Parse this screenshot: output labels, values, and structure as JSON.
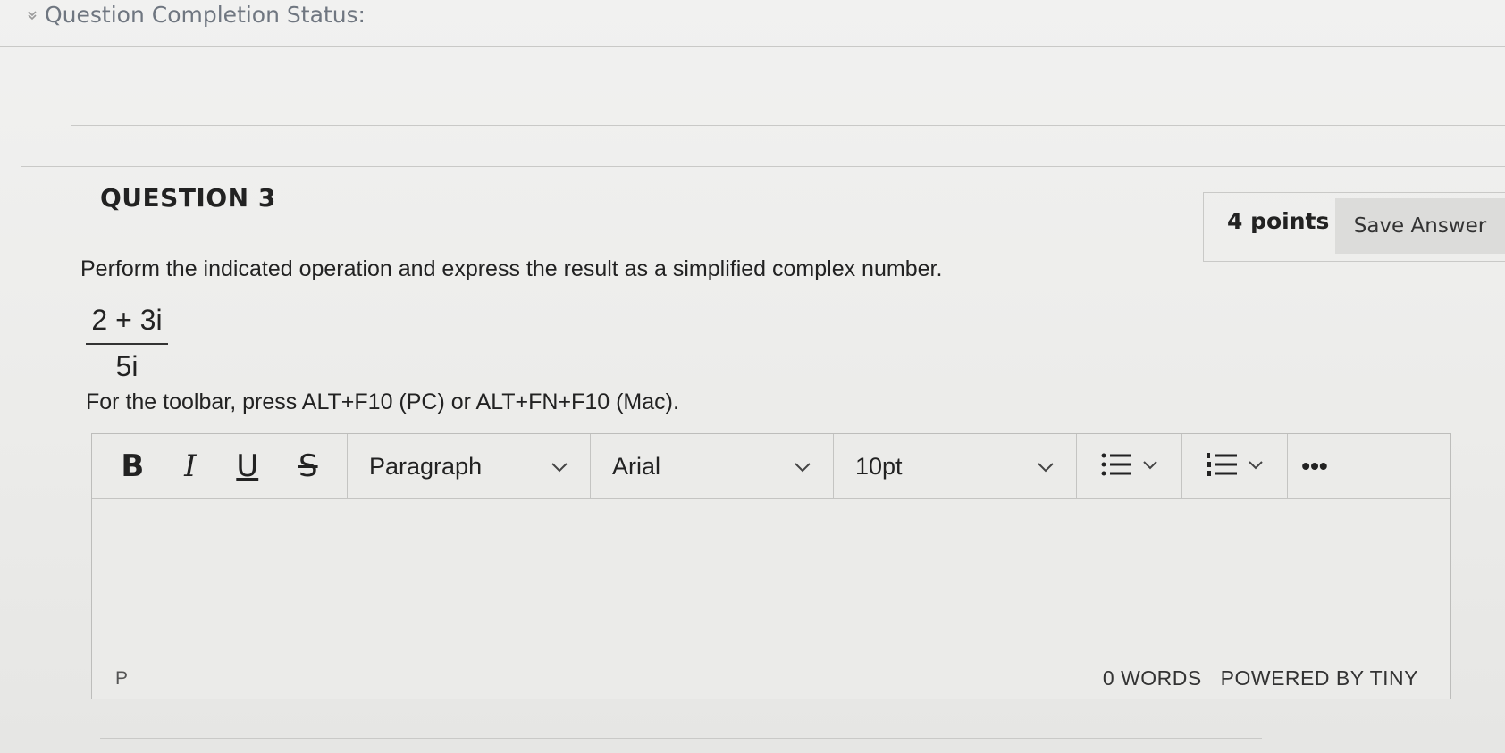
{
  "header": {
    "status_label": "Question Completion Status:"
  },
  "question": {
    "title": "QUESTION 3",
    "points": "4 points",
    "save_label": "Save Answer",
    "prompt": "Perform the indicated operation and express the result as a simplified complex number.",
    "fraction": {
      "numerator": "2 + 3i",
      "denominator": "5i"
    },
    "toolbar_hint": "For the toolbar, press ALT+F10 (PC) or ALT+FN+F10 (Mac)."
  },
  "editor": {
    "format_buttons": {
      "bold": "B",
      "italic": "I",
      "underline": "U",
      "strike": "S"
    },
    "block_format": "Paragraph",
    "font_family": "Arial",
    "font_size": "10pt",
    "more": "•••",
    "path": "P",
    "word_count": "0 WORDS",
    "powered_by": "POWERED BY TINY"
  }
}
